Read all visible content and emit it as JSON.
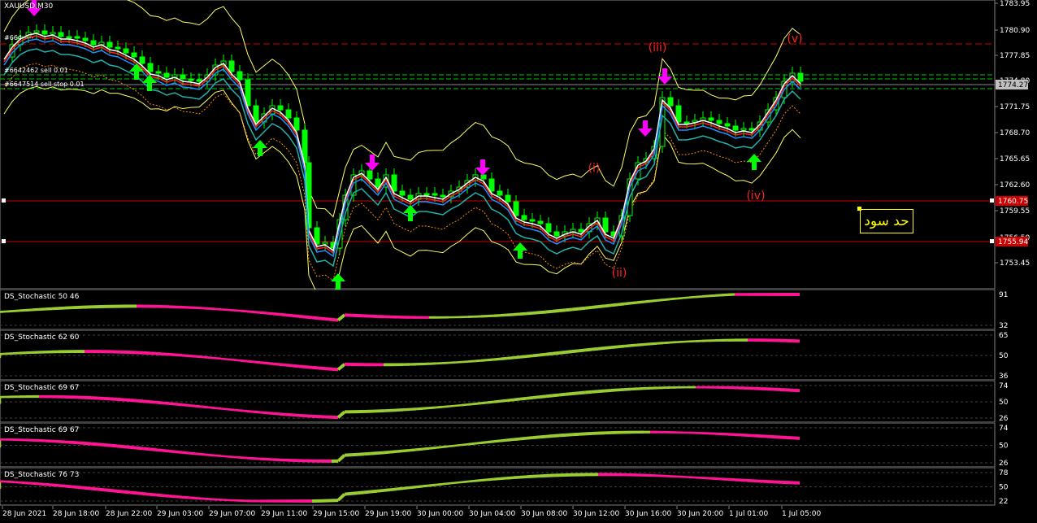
{
  "symbol": "XAUUSD,M30",
  "orders": [
    "#664-----",
    "#6647514 sell stop 0.01",
    "#6642462 sell 0.01"
  ],
  "current_price": "1774.27",
  "price_levels": {
    "upper": "1760.75",
    "lower": "1755.94"
  },
  "main_axis": [
    "1783.95",
    "1780.90",
    "1777.85",
    "1774.80",
    "1771.75",
    "1768.70",
    "1765.65",
    "1762.60",
    "1759.55",
    "1756.50",
    "1753.45"
  ],
  "wave_labels": [
    "(i)",
    "(ii)",
    "(iii)",
    "(iv)",
    "(v)"
  ],
  "annotation": "حد سود",
  "time_axis": [
    "28 Jun 2021",
    "28 Jun 18:00",
    "28 Jun 22:00",
    "29 Jun 03:00",
    "29 Jun 07:00",
    "29 Jun 11:00",
    "29 Jun 15:00",
    "29 Jun 19:00",
    "30 Jun 00:00",
    "30 Jun 04:00",
    "30 Jun 08:00",
    "30 Jun 12:00",
    "30 Jun 16:00",
    "30 Jun 20:00",
    "1 Jul 01:00",
    "1 Jul 05:00"
  ],
  "indicators": [
    {
      "label": "DS_Stochastic 50 46",
      "axis": [
        "91",
        "32"
      ]
    },
    {
      "label": "DS_Stochastic 62 60",
      "axis": [
        "65",
        "50",
        "36"
      ]
    },
    {
      "label": "DS_Stochastic 69 67",
      "axis": [
        "74",
        "50",
        "26"
      ]
    },
    {
      "label": "DS_Stochastic 69 67",
      "axis": [
        "74",
        "50",
        "26"
      ]
    },
    {
      "label": "DS_Stochastic 76 73",
      "axis": [
        "78",
        "50",
        "22"
      ]
    }
  ],
  "colors": {
    "up_candle": "#00ff00",
    "down_candle": "#00ff00",
    "buy_arrow": "#00ff00",
    "sell_arrow": "#ff00ff",
    "level_line": "#cc0000",
    "wave_text": "#ff2222",
    "bollinger": "#ffff66",
    "stoch_up": "#9acd32",
    "stoch_down": "#ff1493",
    "annotation": "#ffff00"
  }
}
